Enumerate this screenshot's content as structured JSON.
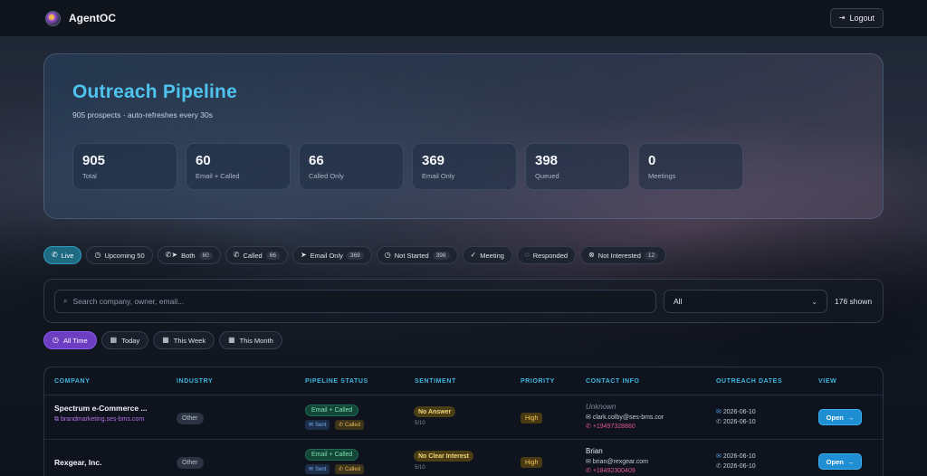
{
  "app": {
    "name": "AgentOC",
    "logout_label": "Logout"
  },
  "hero": {
    "title": "Outreach Pipeline",
    "subtitle": "905 prospects · auto-refreshes every 30s",
    "stats": [
      {
        "value": "905",
        "label": "Total"
      },
      {
        "value": "60",
        "label": "Email + Called"
      },
      {
        "value": "66",
        "label": "Called Only"
      },
      {
        "value": "369",
        "label": "Email Only"
      },
      {
        "value": "398",
        "label": "Queued"
      },
      {
        "value": "0",
        "label": "Meetings"
      }
    ]
  },
  "filters": [
    {
      "label": "Live",
      "count": "",
      "icon": "phone-icon",
      "active": true
    },
    {
      "label": "Upcoming 50",
      "count": "",
      "icon": "clock-icon"
    },
    {
      "label": "Both",
      "count": "60",
      "icon": "phone-send-icon"
    },
    {
      "label": "Called",
      "count": "66",
      "icon": "phone-icon"
    },
    {
      "label": "Email Only",
      "count": "369",
      "icon": "send-icon"
    },
    {
      "label": "Not Started",
      "count": "398",
      "icon": "clock-icon"
    },
    {
      "label": "Meeting",
      "count": "",
      "icon": "check-circle-icon"
    },
    {
      "label": "Responded",
      "count": "",
      "icon": "message-icon"
    },
    {
      "label": "Not Interested",
      "count": "12",
      "icon": "x-circle-icon"
    }
  ],
  "search": {
    "placeholder": "Search company, owner, email...",
    "select_value": "All",
    "shown": "176 shown"
  },
  "time_filters": [
    {
      "label": "All Time",
      "active": true
    },
    {
      "label": "Today"
    },
    {
      "label": "This Week"
    },
    {
      "label": "This Month"
    }
  ],
  "table": {
    "headers": [
      "COMPANY",
      "INDUSTRY",
      "PIPELINE STATUS",
      "SENTIMENT",
      "PRIORITY",
      "CONTACT INFO",
      "OUTREACH DATES",
      "VIEW"
    ],
    "rows": [
      {
        "company": "Spectrum e-Commerce ...",
        "website": "brandmarketing.ses-bms.com",
        "industry": "Other",
        "status": "Email + Called",
        "tag_sent": "Sent",
        "tag_called": "Called",
        "sentiment": "No Answer",
        "score": "5/10",
        "priority": "High",
        "contact_name": "Unknown",
        "contact_email": "clark.colby@ses-bms.cor",
        "contact_phone": "+19497328860",
        "date_email": "2026-06-10",
        "date_call": "2026-06-10",
        "open_label": "Open"
      },
      {
        "company": "Rexgear, Inc.",
        "website": "",
        "industry": "Other",
        "status": "Email + Called",
        "tag_sent": "Sent",
        "tag_called": "Called",
        "sentiment": "No Clear Interest",
        "score": "5/10",
        "priority": "High",
        "contact_name": "Brian",
        "contact_email": "brian@rexgear.com",
        "contact_phone": "+18492300409",
        "date_email": "2026-06-10",
        "date_call": "2026-06-10",
        "open_label": "Open"
      }
    ]
  }
}
